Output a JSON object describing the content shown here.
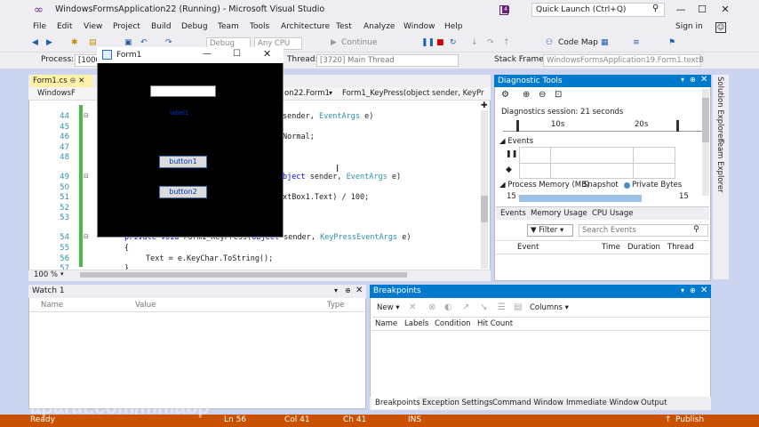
{
  "window": {
    "title": "WindowsFormsApplication22 (Running) - Microsoft Visual Studio",
    "notif_count": "4",
    "quick_launch": "Quick Launch (Ctrl+Q)",
    "sign_in": "Sign in"
  },
  "menu": [
    "File",
    "Edit",
    "View",
    "Project",
    "Build",
    "Debug",
    "Team",
    "Tools",
    "Architecture",
    "Test",
    "Analyze",
    "Window",
    "Help"
  ],
  "toolbar": {
    "config": "Debug",
    "platform": "Any CPU",
    "continue": "Continue",
    "code_map": "Code Map"
  },
  "procbar": {
    "process_label": "Process:",
    "process_value": "[1000]",
    "thread_label": "Thread:",
    "thread_value": "[3720] Main Thread",
    "stack_label": "Stack Frame:",
    "stack_value": "WindowsFormsApplication19.Form1.textB"
  },
  "editor": {
    "tab": "Form1.cs",
    "nav_left": "WindowsF",
    "nav_mid": "on22.Form1",
    "nav_right": "Form1_KeyPress(object sender, KeyPr",
    "zoom": "100 %",
    "line_numbers": [
      "44",
      "45",
      "46",
      "47",
      "48",
      "49",
      "50",
      "51",
      "52",
      "53",
      "54",
      "55",
      "56",
      "57"
    ],
    "l44a": "sender, ",
    "l44b": "EventArgs",
    "l44c": " e)",
    "l46": "Normal;",
    "l49a": "bject",
    "l49b": " sender, ",
    "l49c": "EventArgs",
    "l49d": " e)",
    "l51": "xtBox1.Text) / 100;",
    "l54a": "private void ",
    "l54b": "Form1_KeyPress(",
    "l54c": "object",
    "l54d": " sender, ",
    "l54e": "KeyPressEventArgs",
    "l54f": " e)",
    "l55": "{",
    "l56": "Text = e.KeyChar.ToString();",
    "l57": "}"
  },
  "form1": {
    "title": "Form1",
    "label": "label1",
    "button1": "button1",
    "button2": "button2"
  },
  "diagnostics": {
    "title": "Diagnostic Tools",
    "session": "Diagnostics session: 21 seconds",
    "t10": "10s",
    "t20": "20s",
    "events": "Events",
    "process_memory": "Process Memory (MB)",
    "snapshot": "Snapshot",
    "private_bytes": "Private Bytes",
    "mem_left": "15",
    "mem_right": "15",
    "tabs": [
      "Events",
      "Memory Usage",
      "CPU Usage"
    ],
    "filter": "Filter",
    "search_placeholder": "Search Events",
    "columns": [
      "Event",
      "Time",
      "Duration",
      "Thread"
    ]
  },
  "side_tabs": [
    "Solution Explorer",
    "Team Explorer"
  ],
  "watch": {
    "title": "Watch 1",
    "columns": [
      "Name",
      "Value",
      "Type"
    ]
  },
  "breakpoints": {
    "title": "Breakpoints",
    "new_label": "New",
    "columns_label": "Columns",
    "headers": [
      "Name",
      "Labels",
      "Condition",
      "Hit Count"
    ],
    "bottom_tabs": [
      "Breakpoints",
      "Exception Settings",
      "Command Window",
      "Immediate Window",
      "Output"
    ]
  },
  "status": {
    "ready": "Ready",
    "ln": "Ln 56",
    "col": "Col 41",
    "ch": "Ch 41",
    "ins": "INS",
    "publish": "Publish"
  },
  "watermark": "aparat.com/mmabp"
}
